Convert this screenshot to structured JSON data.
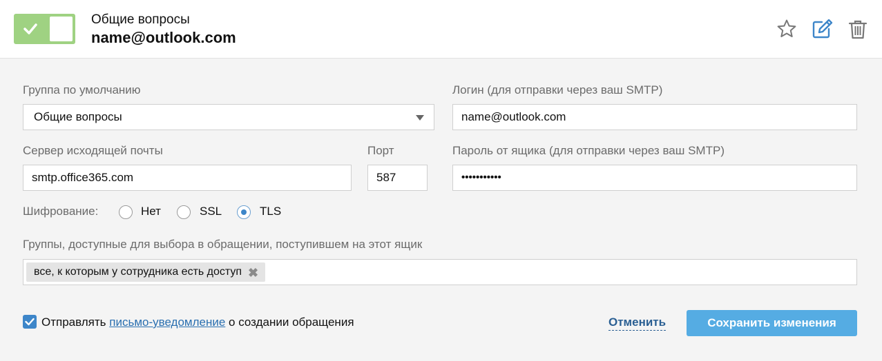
{
  "header": {
    "toggle_state": "on",
    "group_name": "Общие вопросы",
    "email": "name@outlook.com",
    "icons": [
      "star-icon",
      "edit-icon",
      "trash-icon"
    ],
    "toggle_color": "#9fd282",
    "accent_color": "#3d86c9"
  },
  "form": {
    "default_group": {
      "label": "Группа по умолчанию",
      "value": "Общие вопросы"
    },
    "login": {
      "label": "Логин (для отправки через ваш SMTP)",
      "value": "name@outlook.com"
    },
    "smtp_server": {
      "label": "Сервер исходящей почты",
      "value": "smtp.office365.com"
    },
    "port": {
      "label": "Порт",
      "value": "587"
    },
    "password": {
      "label": "Пароль от ящика (для отправки через ваш SMTP)",
      "value": "•••••••••••"
    },
    "encryption": {
      "label": "Шифрование:",
      "options": [
        "Нет",
        "SSL",
        "TLS"
      ],
      "selected": "TLS"
    },
    "groups": {
      "label": "Группы, доступные для выбора в обращении, поступившем на этот ящик",
      "tags": [
        "все, к которым у сотрудника есть доступ"
      ]
    },
    "notify": {
      "checked": true,
      "before": "Отправлять ",
      "link": "письмо-уведомление",
      "after": " о создании обращения"
    }
  },
  "actions": {
    "cancel_label": "Отменить",
    "save_label": "Сохранить изменения",
    "save_color": "#55ace3"
  }
}
